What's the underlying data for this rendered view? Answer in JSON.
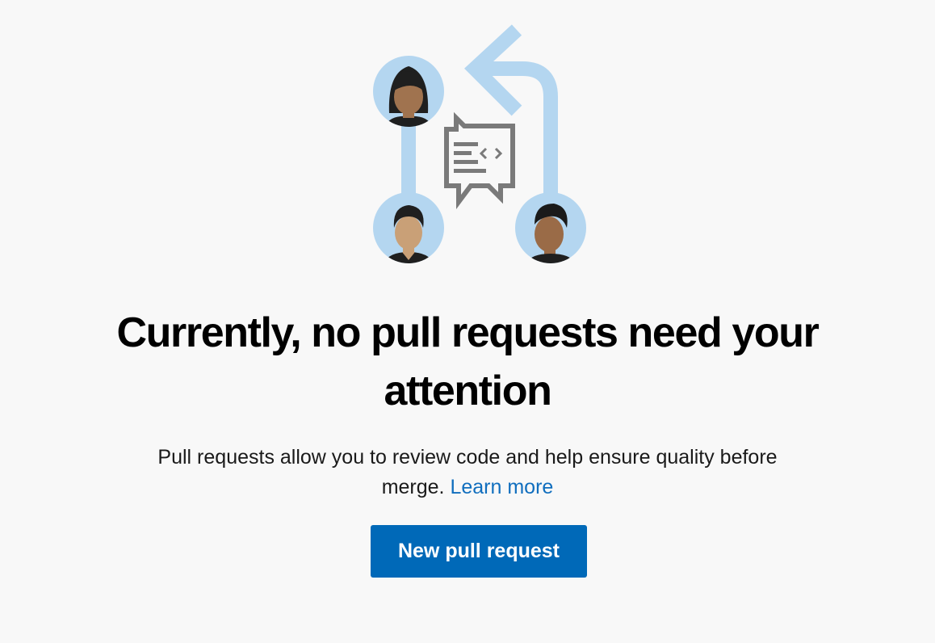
{
  "empty_state": {
    "heading_line1": "Currently, no pull requests need your",
    "heading_line2": "attention",
    "description_line1": "Pull requests allow you to review code and help ensure quality before",
    "description_line2_prefix": "merge.",
    "learn_more_label": "Learn more",
    "new_pr_button_label": "New pull request"
  },
  "colors": {
    "background": "#f8f8f8",
    "accent": "#0069b8",
    "link": "#106ebe",
    "illustration_light_blue": "#b4d6f0",
    "illustration_gray": "#7a7a7a"
  },
  "icons": {
    "illustration": "pull-request-review-illustration",
    "avatars": [
      "reviewer-avatar-woman",
      "reviewer-avatar-man",
      "reviewer-avatar-man-curly"
    ],
    "code-comment": "code-comment-icon"
  }
}
